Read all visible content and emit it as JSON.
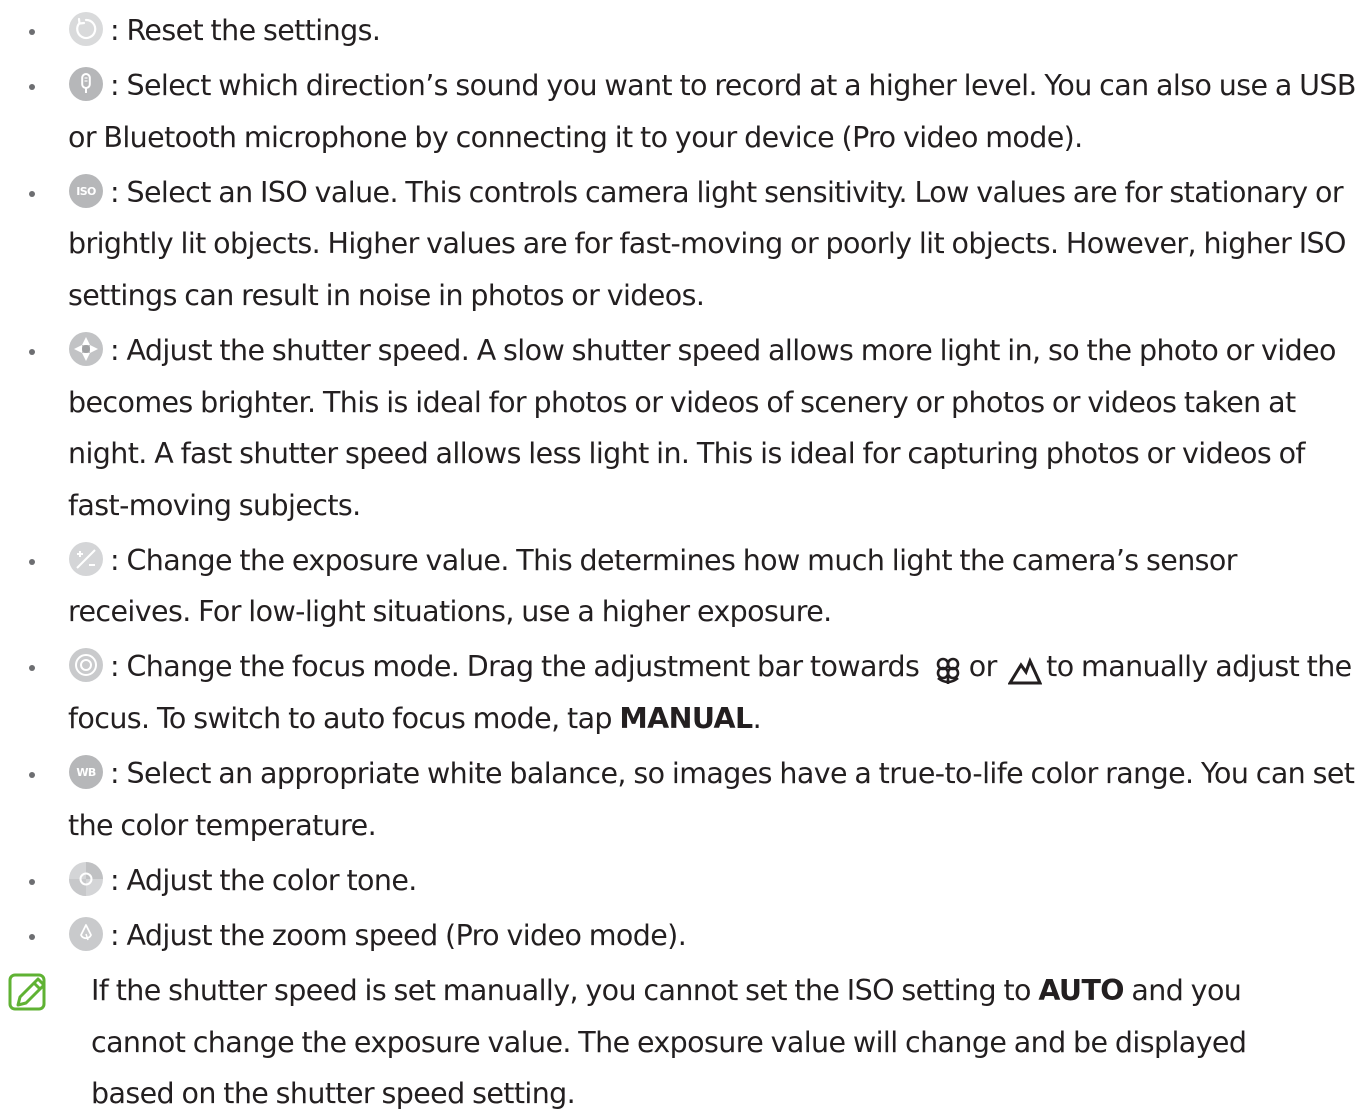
{
  "items": [
    {
      "icon": "reset-icon",
      "text": ": Reset the settings."
    },
    {
      "icon": "microphone-icon",
      "text": ": Select which direction’s sound you want to record at a higher level. You can also use a USB or Bluetooth microphone by connecting it to your device (Pro video mode)."
    },
    {
      "icon": "iso-icon",
      "icon_label": "ISO",
      "text": ": Select an ISO value. This controls camera light sensitivity. Low values are for stationary or brightly lit objects. Higher values are for fast-moving or poorly lit objects. However, higher ISO settings can result in noise in photos or videos."
    },
    {
      "icon": "shutter-speed-icon",
      "text": ": Adjust the shutter speed. A slow shutter speed allows more light in, so the photo or video becomes brighter. This is ideal for photos or videos of scenery or photos or videos taken at night. A fast shutter speed allows less light in. This is ideal for capturing photos or videos of fast-moving subjects."
    },
    {
      "icon": "exposure-icon",
      "text": ": Change the exposure value. This determines how much light the camera’s sensor receives. For low-light situations, use a higher exposure."
    },
    {
      "icon": "focus-icon",
      "text_a": ": Change the focus mode. Drag the adjustment bar towards",
      "macro_icon": "macro-flower-icon",
      "text_b": "or",
      "landscape_icon": "mountain-icon",
      "text_c": "to manually adjust the focus. To switch to auto focus mode, tap",
      "strong": "MANUAL",
      "text_d": "."
    },
    {
      "icon": "white-balance-icon",
      "icon_label": "WB",
      "text": ": Select an appropriate white balance, so images have a true-to-life color range. You can set the color temperature."
    },
    {
      "icon": "color-tone-icon",
      "text": ": Adjust the color tone."
    },
    {
      "icon": "zoom-speed-icon",
      "text": ": Adjust the zoom speed (Pro video mode)."
    }
  ],
  "note": {
    "icon": "note-pencil-icon",
    "text_a": "If the shutter speed is set manually, you cannot set the ISO setting to",
    "strong": "AUTO",
    "text_b": "and you cannot change the exposure value. The exposure value will change and be displayed based on the shutter speed setting."
  },
  "colors": {
    "text": "#231f20",
    "icon_gray": "#b6b7b9",
    "icon_light": "#d4d5d7",
    "note_green": "#5fb233"
  }
}
